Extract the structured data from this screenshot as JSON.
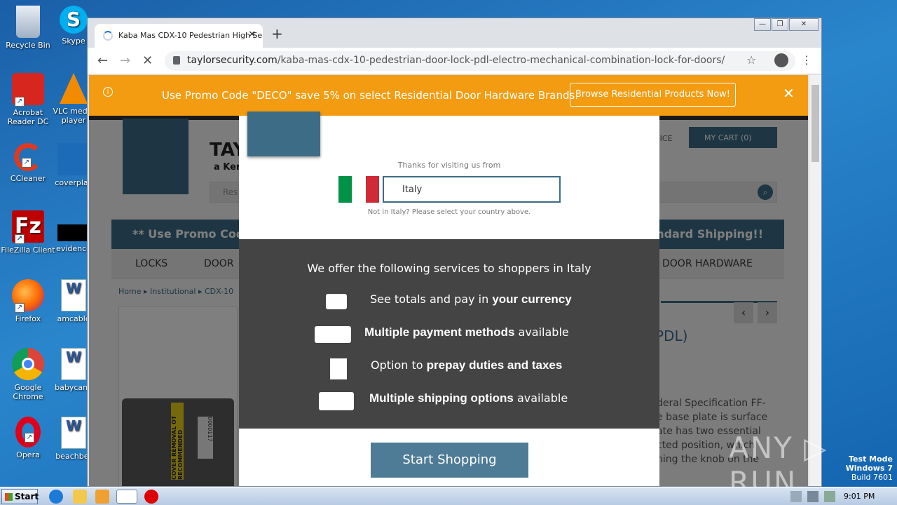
{
  "desktop_icons": [
    {
      "label": "Recycle Bin"
    },
    {
      "label": "Skype"
    },
    {
      "label": "Acrobat Reader DC"
    },
    {
      "label": "VLC media player"
    },
    {
      "label": "CCleaner"
    },
    {
      "label": "coverplac"
    },
    {
      "label": "FileZilla Client"
    },
    {
      "label": "evidence"
    },
    {
      "label": "Firefox"
    },
    {
      "label": "amcable"
    },
    {
      "label": "Google Chrome"
    },
    {
      "label": "babycana"
    },
    {
      "label": "Opera"
    },
    {
      "label": "beachbet"
    }
  ],
  "browser": {
    "tab_title": "Kaba Mas CDX-10 Pedestrian High Se",
    "url_host": "taylorsecurity.com",
    "url_path": "/kaba-mas-cdx-10-pedestrian-door-lock-pdl-electro-mechanical-combination-lock-for-doors/"
  },
  "promo": {
    "message": "Use Promo Code \"DECO\" save 5% on select Residential Door Hardware Brands.",
    "button": "Browse Residential Products Now!",
    "info_glyph": "i",
    "close_glyph": "✕"
  },
  "site": {
    "brand": "TAY",
    "brand_sub": "a Ker",
    "search_placeholder": "Res",
    "service": "RVICE",
    "cart": "MY CART (0)",
    "promobar_left": "** Use Promo Code",
    "promobar_right": "tandard Shipping!!",
    "nav": [
      "LOCKS",
      "DOOR",
      "DOOR HARDWARE"
    ],
    "crumbs": [
      "Home",
      "Institutional",
      "CDX-10"
    ],
    "product_title_fragment": "PDL)",
    "desc_lines": [
      "deral Specification FF-",
      "e base plate is surface",
      "ate has two essential",
      "cted position, which",
      "ning the knob on the"
    ],
    "label_text": "COVER REMOVAL OT RECOMMENDED",
    "serial": "0000117"
  },
  "modal": {
    "thanks": "Thanks for visiting us from",
    "country": "Italy",
    "not_in": "Not in Italy? Please select your country above.",
    "offer": "We offer the following services to shoppers in Italy",
    "services": [
      {
        "pre": "See totals and pay in ",
        "bold": "your currency",
        "post": ""
      },
      {
        "pre": "",
        "bold": "Multiple payment methods",
        "post": " available"
      },
      {
        "pre": "Option to ",
        "bold": "prepay duties and taxes",
        "post": ""
      },
      {
        "pre": "",
        "bold": "Multiple shipping options",
        "post": " available"
      }
    ],
    "cta": "Start Shopping",
    "flag_colors": [
      "#009246",
      "#ffffff",
      "#ce2b37"
    ]
  },
  "taskbar": {
    "start": "Start",
    "clock": "9:01 PM"
  },
  "watermark": {
    "brand": "ANY ▷ RUN",
    "test_mode": "Test Mode",
    "os": "Windows 7",
    "build": "Build 7601"
  }
}
